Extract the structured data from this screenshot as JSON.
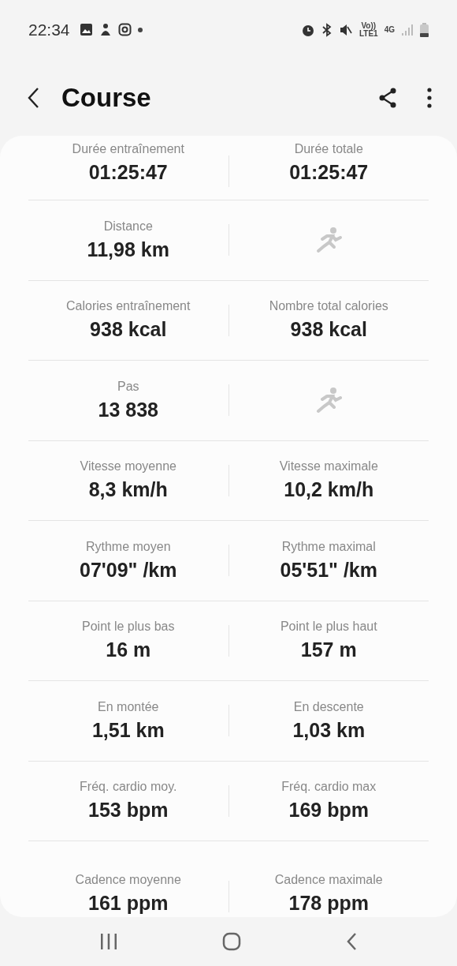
{
  "status_bar": {
    "time": "22:34",
    "network_label": "Vo))\nLTE1",
    "data_label": "4G"
  },
  "header": {
    "title": "Course"
  },
  "rows": [
    {
      "cells": [
        {
          "kind": "stat",
          "label": "Durée entraînement",
          "value": "01:25:47"
        },
        {
          "kind": "stat",
          "label": "Durée totale",
          "value": "01:25:47"
        }
      ]
    },
    {
      "cells": [
        {
          "kind": "stat",
          "label": "Distance",
          "value": "11,98 km"
        },
        {
          "kind": "icon"
        }
      ]
    },
    {
      "cells": [
        {
          "kind": "stat",
          "label": "Calories entraînement",
          "value": "938 kcal"
        },
        {
          "kind": "stat",
          "label": "Nombre total calories",
          "value": "938 kcal"
        }
      ]
    },
    {
      "cells": [
        {
          "kind": "stat",
          "label": "Pas",
          "value": "13 838"
        },
        {
          "kind": "icon"
        }
      ]
    },
    {
      "cells": [
        {
          "kind": "stat",
          "label": "Vitesse moyenne",
          "value": "8,3 km/h"
        },
        {
          "kind": "stat",
          "label": "Vitesse maximale",
          "value": "10,2 km/h"
        }
      ]
    },
    {
      "cells": [
        {
          "kind": "stat",
          "label": "Rythme moyen",
          "value": "07'09\" /km"
        },
        {
          "kind": "stat",
          "label": "Rythme maximal",
          "value": "05'51\" /km"
        }
      ]
    },
    {
      "cells": [
        {
          "kind": "stat",
          "label": "Point le plus bas",
          "value": "16 m"
        },
        {
          "kind": "stat",
          "label": "Point le plus haut",
          "value": "157 m"
        }
      ]
    },
    {
      "cells": [
        {
          "kind": "stat",
          "label": "En montée",
          "value": "1,51 km"
        },
        {
          "kind": "stat",
          "label": "En descente",
          "value": "1,03 km"
        }
      ]
    },
    {
      "cells": [
        {
          "kind": "stat",
          "label": "Fréq. cardio moy.",
          "value": "153 bpm"
        },
        {
          "kind": "stat",
          "label": "Fréq. cardio max",
          "value": "169 bpm"
        }
      ]
    },
    {
      "cells": [
        {
          "kind": "stat",
          "label": "Cadence moyenne",
          "value": "161 ppm"
        },
        {
          "kind": "stat",
          "label": "Cadence maximale",
          "value": "178 ppm"
        }
      ]
    }
  ]
}
